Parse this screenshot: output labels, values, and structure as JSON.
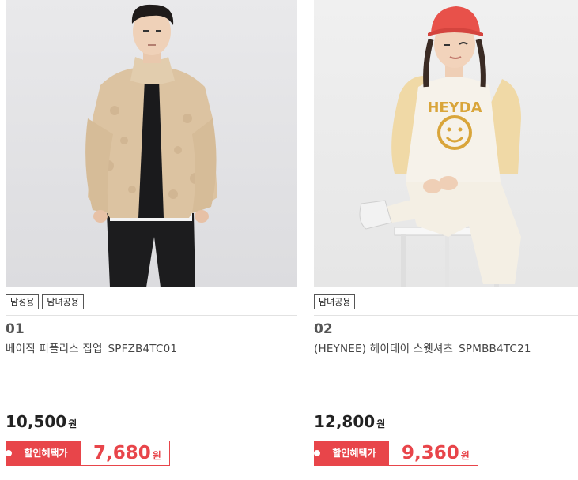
{
  "products": [
    {
      "tags": [
        "남성용",
        "남녀공용"
      ],
      "number": "01",
      "name": "베이직 퍼플리스 집업_SPFZB4TC01",
      "price": "10,500",
      "price_unit": "원",
      "promo_label": "할인혜택가",
      "promo_price": "7,680",
      "promo_unit": "원"
    },
    {
      "tags": [
        "남녀공용"
      ],
      "number": "02",
      "name": "(HEYNEE) 헤이데이 스웻셔츠_SPMBB4TC21",
      "price": "12,800",
      "price_unit": "원",
      "promo_label": "할인혜택가",
      "promo_price": "9,360",
      "promo_unit": "원",
      "image_print": "HEYDA"
    }
  ],
  "colors": {
    "promo_red": "#e8454a",
    "tag_border": "#555555"
  }
}
